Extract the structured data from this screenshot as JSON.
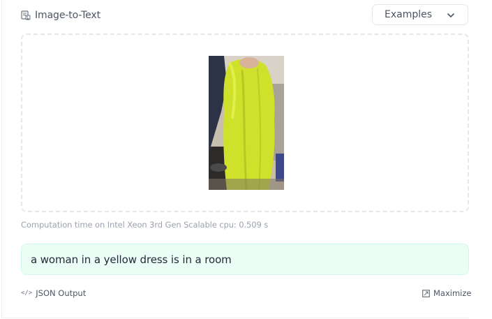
{
  "widget": {
    "task_label": "Image-to-Text",
    "task_icon": "image-to-text-icon",
    "examples_label": "Examples",
    "examples_icon": "chevron-down-icon"
  },
  "preview": {
    "description_icon": "uploaded-image"
  },
  "result": {
    "computation_text": "Computation time on Intel Xeon 3rd Gen Scalable cpu: 0.509 s",
    "output_text": "a woman in a yellow dress is in a room"
  },
  "footer": {
    "json_output_label": "JSON Output",
    "json_icon": "code-icon",
    "maximize_label": "Maximize",
    "maximize_icon": "maximize-icon"
  },
  "colors": {
    "output_bg": "#ecfdf5",
    "output_border": "#d1fae5",
    "dress": "#d4e32a"
  }
}
